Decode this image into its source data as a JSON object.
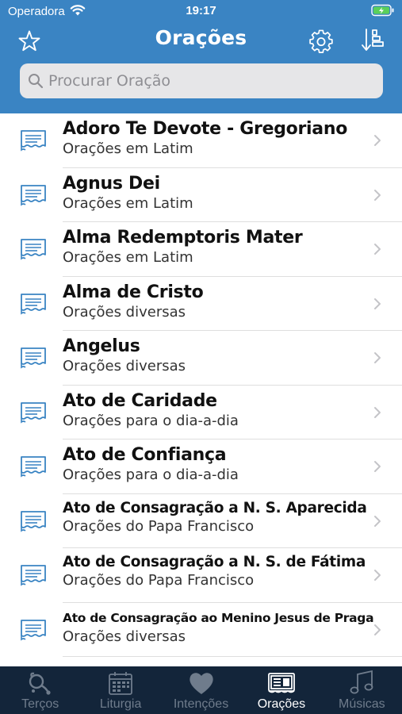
{
  "status_bar": {
    "carrier": "Operadora",
    "time": "19:17"
  },
  "nav": {
    "title": "Orações"
  },
  "search": {
    "placeholder": "Procurar Oração"
  },
  "colors": {
    "header": "#3a84c3",
    "tabbar": "#13253a",
    "icon_blue": "#3a84c3"
  },
  "prayers": [
    {
      "title": "Adoro Te Devote - Gregoriano",
      "subtitle": "Orações em Latim",
      "icon": "prayer-card-icon"
    },
    {
      "title": "Agnus Dei",
      "subtitle": "Orações em Latim",
      "icon": "prayer-card-icon"
    },
    {
      "title": "Alma Redemptoris Mater",
      "subtitle": "Orações em Latim",
      "icon": "prayer-card-icon"
    },
    {
      "title": "Alma de Cristo",
      "subtitle": "Orações diversas",
      "icon": "prayer-card-icon"
    },
    {
      "title": "Angelus",
      "subtitle": "Orações diversas",
      "icon": "prayer-card-icon"
    },
    {
      "title": "Ato de Caridade",
      "subtitle": "Orações para o dia-a-dia",
      "icon": "prayer-card-icon"
    },
    {
      "title": "Ato de Confiança",
      "subtitle": "Orações para o dia-a-dia",
      "icon": "prayer-card-icon"
    },
    {
      "title": "Ato de Consagração a N. S. Aparecida",
      "subtitle": "Orações do Papa Francisco",
      "icon": "prayer-card-icon"
    },
    {
      "title": "Ato de Consagração a N. S. de Fátima",
      "subtitle": "Orações do Papa Francisco",
      "icon": "prayer-card-icon"
    },
    {
      "title": "Ato de Consagração ao Menino Jesus de Praga",
      "subtitle": "Orações diversas",
      "icon": "prayer-card-icon"
    }
  ],
  "tabs": [
    {
      "label": "Terços",
      "icon": "rosary-icon",
      "active": false
    },
    {
      "label": "Liturgia",
      "icon": "calendar-icon",
      "active": false
    },
    {
      "label": "Intenções",
      "icon": "heart-icon",
      "active": false
    },
    {
      "label": "Orações",
      "icon": "prayer-cards-icon",
      "active": true
    },
    {
      "label": "Músicas",
      "icon": "music-note-icon",
      "active": false
    }
  ]
}
